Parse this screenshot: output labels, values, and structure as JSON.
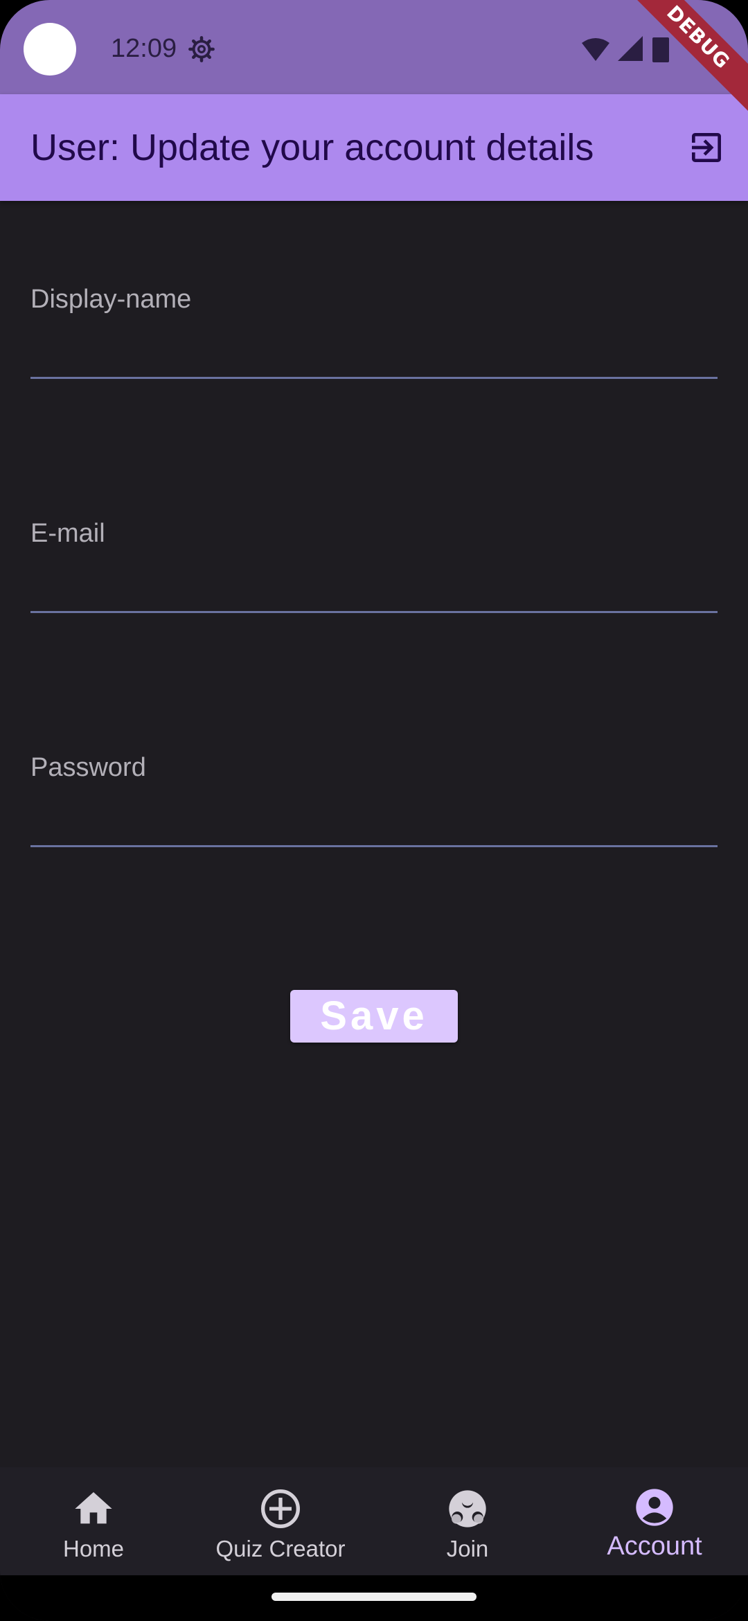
{
  "status_bar": {
    "time": "12:09",
    "debug_label": "DEBUG"
  },
  "app_bar": {
    "title": "User: Update your account details",
    "action_icon": "logout-icon"
  },
  "form": {
    "display_name": {
      "label": "Display-name",
      "value": ""
    },
    "email": {
      "label": "E-mail",
      "value": ""
    },
    "password": {
      "label": "Password",
      "value": ""
    },
    "save_label": "Save"
  },
  "bottom_nav": {
    "items": [
      {
        "label": "Home",
        "icon": "home-icon",
        "active": false
      },
      {
        "label": "Quiz Creator",
        "icon": "add-circle-icon",
        "active": false
      },
      {
        "label": "Join",
        "icon": "group-icon",
        "active": false
      },
      {
        "label": "Account",
        "icon": "account-circle-icon",
        "active": true
      }
    ]
  },
  "colors": {
    "status_bar": "#8468b5",
    "app_bar": "#ad89ee",
    "background": "#1e1c21",
    "accent": "#d5bbff",
    "save_button": "#dcc7fe",
    "underline": "#6a72a0"
  }
}
